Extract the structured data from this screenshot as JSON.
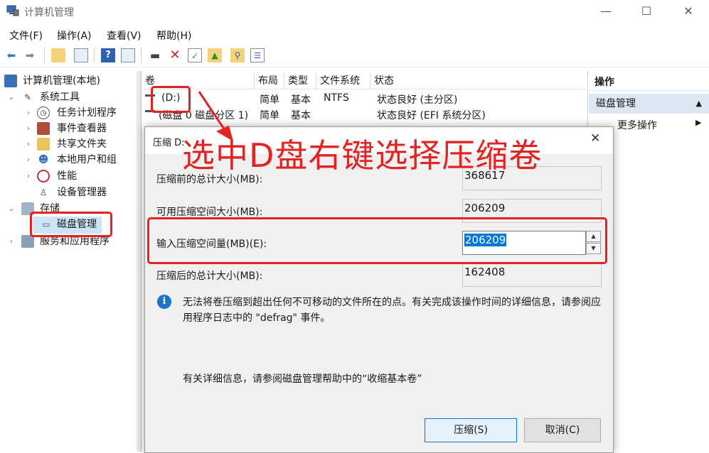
{
  "window": {
    "title": "计算机管理",
    "minimize": "—",
    "maximize": "☐",
    "close": "✕"
  },
  "menu": [
    "文件(F)",
    "操作(A)",
    "查看(V)",
    "帮助(H)"
  ],
  "tree": {
    "root": "计算机管理(本地)",
    "system_tools": "系统工具",
    "task_scheduler": "任务计划程序",
    "event_viewer": "事件查看器",
    "shared_folders": "共享文件夹",
    "local_users": "本地用户和组",
    "performance": "性能",
    "device_manager": "设备管理器",
    "storage": "存储",
    "disk_management": "磁盘管理",
    "services_apps": "服务和应用程序"
  },
  "volumes": {
    "columns": [
      "卷",
      "布局",
      "类型",
      "文件系统",
      "状态"
    ],
    "rows": [
      {
        "volume": "(D:)",
        "layout": "简单",
        "type": "基本",
        "fs": "NTFS",
        "status": "状态良好 (主分区)"
      },
      {
        "volume": "(磁盘 0 磁盘分区 1)",
        "layout": "简单",
        "type": "基本",
        "fs": "",
        "status": "状态良好 (EFI 系统分区)"
      }
    ]
  },
  "actions": {
    "title": "操作",
    "section": "磁盘管理",
    "section_arrow": "▲",
    "more": "更多操作",
    "more_arrow": "▶"
  },
  "dialog": {
    "title": "压缩 D:",
    "close": "✕",
    "total_before_label": "压缩前的总计大小(MB):",
    "total_before_value": "368617",
    "available_label": "可用压缩空间大小(MB):",
    "available_value": "206209",
    "amount_label": "输入压缩空间量(MB)(E):",
    "amount_value": "206209",
    "total_after_label": "压缩后的总计大小(MB):",
    "total_after_value": "162408",
    "info_text": "无法将卷压缩到超出任何不可移动的文件所在的点。有关完成该操作时间的详细信息，请参阅应用程序日志中的 \"defrag\" 事件。",
    "help_text": "有关详细信息，请参阅磁盘管理帮助中的“收缩基本卷”",
    "shrink_button": "压缩(S)",
    "cancel_button": "取消(C)"
  },
  "annotation": "选中D盘右键选择压缩卷",
  "colors": {
    "annotation_red": "#e32222",
    "selection_blue": "#0078d7",
    "action_header_bg": "#dde8f3",
    "dialog_bg": "#f0f0f0"
  }
}
